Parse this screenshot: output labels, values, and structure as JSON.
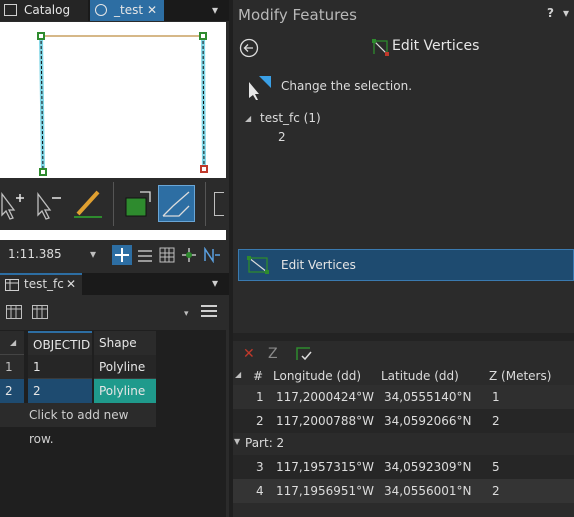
{
  "left_tabs": {
    "catalog": "Catalog",
    "test": "_test",
    "test_close": "✕",
    "dropdown": "▾"
  },
  "map": {
    "scale": "1:11.385"
  },
  "attribute_table": {
    "tab_label": "test_fc",
    "tab_close": "✕",
    "headers": [
      "OBJECTID",
      "Shape"
    ],
    "rows": [
      {
        "num": "1",
        "objectid": "1",
        "shape": "Polyline Z"
      },
      {
        "num": "2",
        "objectid": "2",
        "shape": "Polyline Z"
      }
    ],
    "add_row": "Click to add new row."
  },
  "modify": {
    "title": "Modify Features",
    "help": "?",
    "pane_title": "Edit Vertices",
    "change_selection": "Change the selection.",
    "tree_layer": "test_fc (1)",
    "tree_item": "2",
    "tool_label": "Edit Vertices"
  },
  "vertices": {
    "z_label": "Z",
    "headers": [
      "#",
      "Longitude (dd)",
      "Latitude (dd)",
      "Z (Meters)"
    ],
    "part1": [
      {
        "n": "1",
        "lon": "117,2000424°W",
        "lat": "34,0555140°N",
        "z": "1"
      },
      {
        "n": "2",
        "lon": "117,2000788°W",
        "lat": "34,0592066°N",
        "z": "2"
      }
    ],
    "part2_label": "Part: 2",
    "part2": [
      {
        "n": "3",
        "lon": "117,1957315°W",
        "lat": "34,0592309°N",
        "z": "5"
      },
      {
        "n": "4",
        "lon": "117,1956951°W",
        "lat": "34,0556001°N",
        "z": "2"
      }
    ]
  },
  "colors": {
    "accent": "#2d6ea3",
    "selected_row": "#1e4b70",
    "shape_highlight": "#1f9a8c",
    "vertex_green": "#2e8b2e",
    "vertex_red": "#c0392b"
  }
}
